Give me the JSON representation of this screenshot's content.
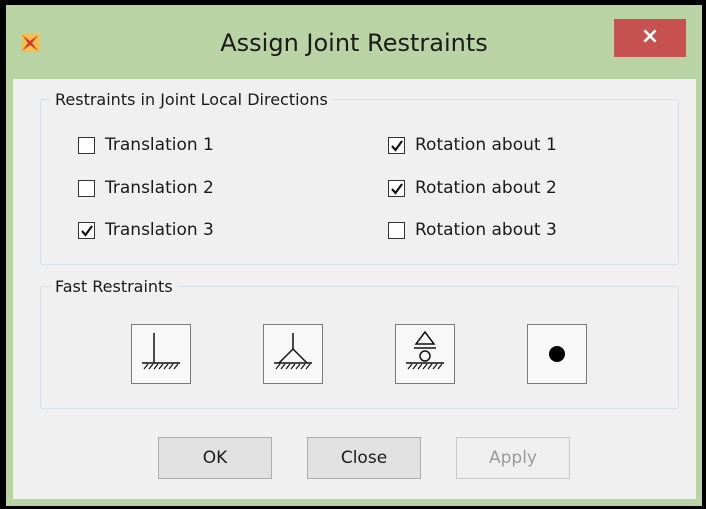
{
  "window": {
    "title": "Assign Joint Restraints",
    "close_glyph": "×"
  },
  "group_directions": {
    "legend": "Restraints in Joint Local Directions",
    "options": [
      {
        "label": "Translation 1",
        "checked": false
      },
      {
        "label": "Translation 2",
        "checked": false
      },
      {
        "label": "Translation 3",
        "checked": true
      },
      {
        "label": "Rotation about 1",
        "checked": true
      },
      {
        "label": "Rotation about 2",
        "checked": true
      },
      {
        "label": "Rotation about 3",
        "checked": false
      }
    ]
  },
  "group_fast": {
    "legend": "Fast Restraints",
    "icons": [
      "fixed-support-icon",
      "pinned-support-icon",
      "roller-support-icon",
      "free-joint-icon"
    ]
  },
  "buttons": {
    "ok": "OK",
    "close": "Close",
    "apply": "Apply"
  }
}
